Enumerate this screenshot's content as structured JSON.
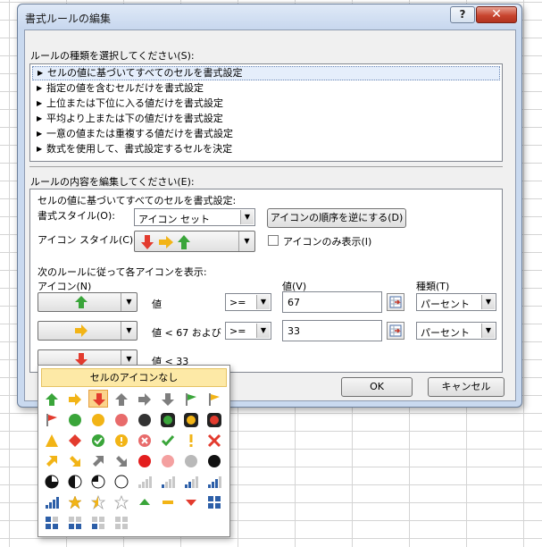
{
  "window": {
    "title": "書式ルールの編集",
    "help_label": "?",
    "close_label": "✕"
  },
  "rule_type": {
    "label": "ルールの種類を選択してください(S):",
    "items": [
      "セルの値に基づいてすべてのセルを書式設定",
      "指定の値を含むセルだけを書式設定",
      "上位または下位に入る値だけを書式設定",
      "平均より上または下の値だけを書式設定",
      "一意の値または重複する値だけを書式設定",
      "数式を使用して、書式設定するセルを決定"
    ]
  },
  "rule_edit": {
    "label": "ルールの内容を編集してください(E):",
    "desc": "セルの値に基づいてすべてのセルを書式設定:",
    "format_style_label": "書式スタイル(O):",
    "format_style_value": "アイコン セット",
    "reverse_button": "アイコンの順序を逆にする(D)",
    "icon_style_label": "アイコン スタイル(C):",
    "icon_only_label": "アイコンのみ表示(I)",
    "rules_heading": "次のルールに従って各アイコンを表示:",
    "icon_col": "アイコン(N)",
    "value_col": "値(V)",
    "type_col": "種類(T)",
    "rows": [
      {
        "cond": "値",
        "op": ">=",
        "value": "67",
        "type": "パーセント"
      },
      {
        "cond": "値 < 67 および",
        "op": ">=",
        "value": "33",
        "type": "パーセント"
      },
      {
        "cond": "値 < 33"
      }
    ]
  },
  "buttons": {
    "ok": "OK",
    "cancel": "キャンセル"
  },
  "icon_picker": {
    "no_icon": "セルのアイコンなし"
  },
  "colors": {
    "green": "#3aa53a",
    "yellow": "#f2b416",
    "red": "#e33b2e",
    "gray": "#7e7e7e"
  }
}
